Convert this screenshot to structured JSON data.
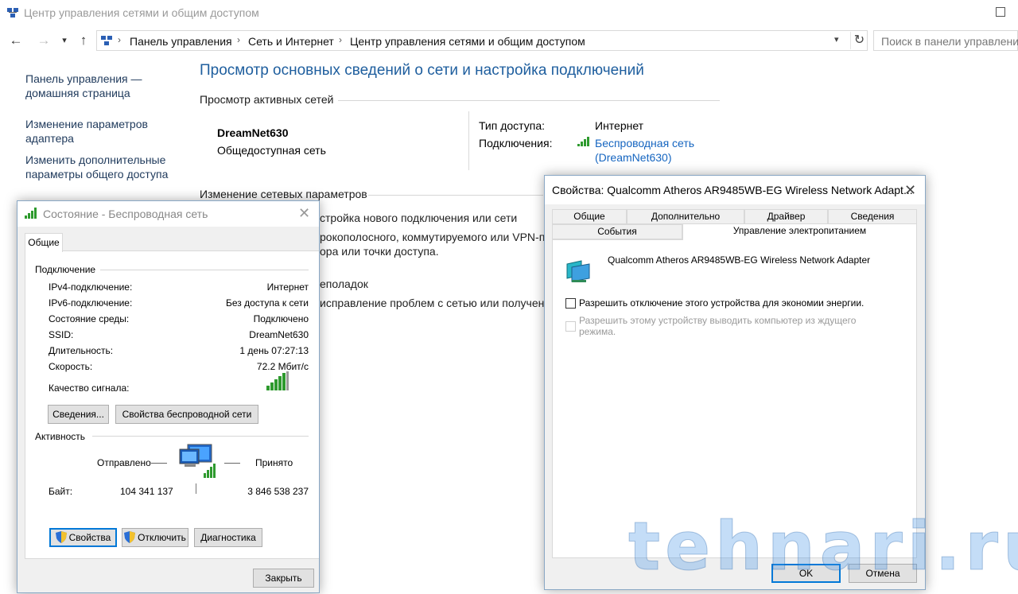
{
  "window": {
    "title": "Центр управления сетями и общим доступом"
  },
  "nav": {
    "breadcrumbs": [
      "Панель управления",
      "Сеть и Интернет",
      "Центр управления сетями и общим доступом"
    ],
    "search_placeholder": "Поиск в панели управления"
  },
  "sidebar": {
    "home_link": "Панель управления — домашняя страница",
    "adapter_link": "Изменение параметров адаптера",
    "sharing_link": "Изменить дополнительные параметры общего доступа"
  },
  "main": {
    "heading": "Просмотр основных сведений о сети и настройка подключений",
    "active_networks_label": "Просмотр активных сетей",
    "network_name": "DreamNet630",
    "network_type": "Общедоступная сеть",
    "access_type_label": "Тип доступа:",
    "access_type_value": "Интернет",
    "connections_label": "Подключения:",
    "connection_link_line1": "Беспроводная сеть",
    "connection_link_line2": "(DreamNet630)",
    "change_settings_label": "Изменение сетевых параметров",
    "new_connection_partial": "стройка нового подключения или сети",
    "new_connection_desc1": "рокополосного, коммутируемого или VPN-п",
    "new_connection_desc2": "ора или точки доступа.",
    "troubleshoot_partial": "еполадок",
    "troubleshoot_desc": "исправление проблем с сетью или получен"
  },
  "status_dialog": {
    "title": "Состояние - Беспроводная сеть",
    "tab": "Общие",
    "connection_group": "Подключение",
    "rows": [
      {
        "label": "IPv4-подключение:",
        "value": "Интернет"
      },
      {
        "label": "IPv6-подключение:",
        "value": "Без доступа к сети"
      },
      {
        "label": "Состояние среды:",
        "value": "Подключено"
      },
      {
        "label": "SSID:",
        "value": "DreamNet630"
      },
      {
        "label": "Длительность:",
        "value": "1 день 07:27:13"
      },
      {
        "label": "Скорость:",
        "value": "72.2 Мбит/с"
      }
    ],
    "signal_label": "Качество сигнала:",
    "details_button": "Сведения...",
    "wireless_props_button": "Свойства беспроводной сети",
    "activity_group": "Активность",
    "sent_label": "Отправлено",
    "received_label": "Принято",
    "bytes_label": "Байт:",
    "bytes_sent": "104 341 137",
    "bytes_received": "3 846 538 237",
    "properties_button": "Свойства",
    "disable_button": "Отключить",
    "diagnostics_button": "Диагностика",
    "close_button": "Закрыть"
  },
  "props_dialog": {
    "title": "Свойства: Qualcomm Atheros AR9485WB-EG Wireless Network Adapt...",
    "tabs_row1": [
      "Общие",
      "Дополнительно",
      "Драйвер",
      "Сведения"
    ],
    "tabs_row2": [
      "События",
      "Управление электропитанием"
    ],
    "adapter_name": "Qualcomm Atheros AR9485WB-EG Wireless Network Adapter",
    "option1": "Разрешить отключение этого устройства для экономии энергии.",
    "option2_line1": "Разрешить этому устройству выводить компьютер из ждущего",
    "option2_line2": "режима.",
    "ok_button": "OK",
    "cancel_button": "Отмена"
  },
  "watermark": "tehnari.ru",
  "colors": {
    "link": "#1565c0",
    "heading": "#1e5e9e",
    "signal": "#2e9a2e",
    "focus": "#0078d7"
  }
}
